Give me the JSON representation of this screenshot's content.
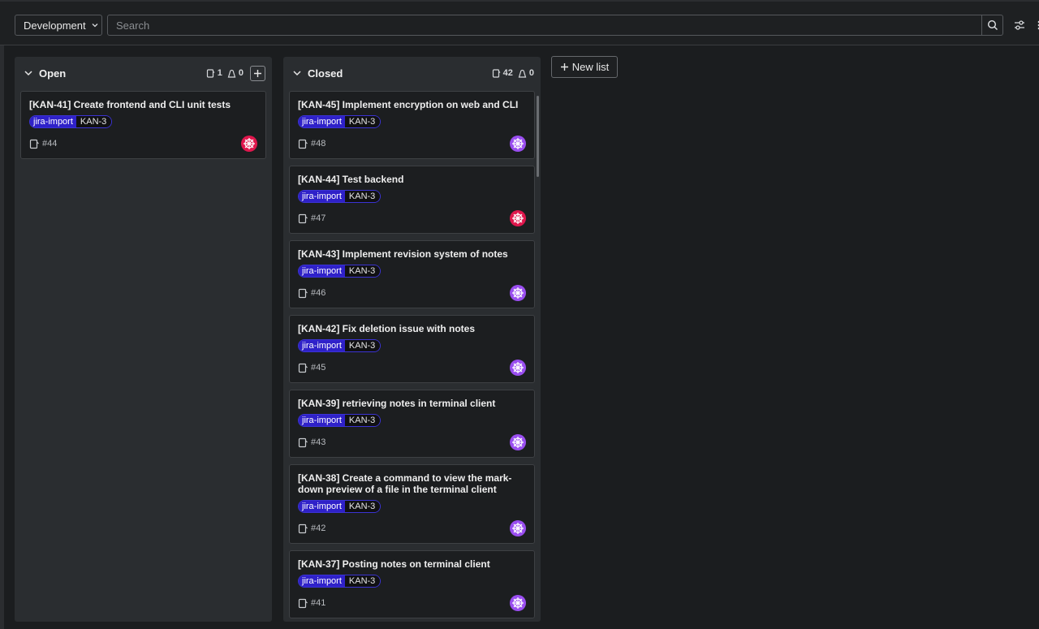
{
  "toolbar": {
    "board_selector": "Development",
    "search_placeholder": "Search"
  },
  "colors": {
    "label_scope_bg": "#2f21c9",
    "avatar_red": "#e0174d",
    "avatar_purple": "#9a4ef0"
  },
  "lists": [
    {
      "title": "Open",
      "issue_count": "1",
      "weight": "0",
      "cards": [
        {
          "title": "[KAN-41] Create frontend and CLI unit tests",
          "label_scope": "jira-import",
          "label_value": "KAN-3",
          "number": "#44",
          "avatar": "red"
        }
      ]
    },
    {
      "title": "Closed",
      "issue_count": "42",
      "weight": "0",
      "cards": [
        {
          "title": "[KAN-45] Implement encryption on web and CLI",
          "label_scope": "jira-import",
          "label_value": "KAN-3",
          "number": "#48",
          "avatar": "purple"
        },
        {
          "title": "[KAN-44] Test backend",
          "label_scope": "jira-import",
          "label_value": "KAN-3",
          "number": "#47",
          "avatar": "red"
        },
        {
          "title": "[KAN-43] Implement revision system of notes",
          "label_scope": "jira-import",
          "label_value": "KAN-3",
          "number": "#46",
          "avatar": "purple"
        },
        {
          "title": "[KAN-42] Fix deletion issue with notes",
          "label_scope": "jira-import",
          "label_value": "KAN-3",
          "number": "#45",
          "avatar": "purple"
        },
        {
          "title": "[KAN-39] retrieving notes in terminal client",
          "label_scope": "jira-import",
          "label_value": "KAN-3",
          "number": "#43",
          "avatar": "purple"
        },
        {
          "title": "[KAN-38] Create a command to view the mark-down preview of a file in the terminal client",
          "label_scope": "jira-import",
          "label_value": "KAN-3",
          "number": "#42",
          "avatar": "purple"
        },
        {
          "title": "[KAN-37] Posting notes on terminal client",
          "label_scope": "jira-import",
          "label_value": "KAN-3",
          "number": "#41",
          "avatar": "purple"
        }
      ]
    }
  ],
  "new_list_label": "New list"
}
